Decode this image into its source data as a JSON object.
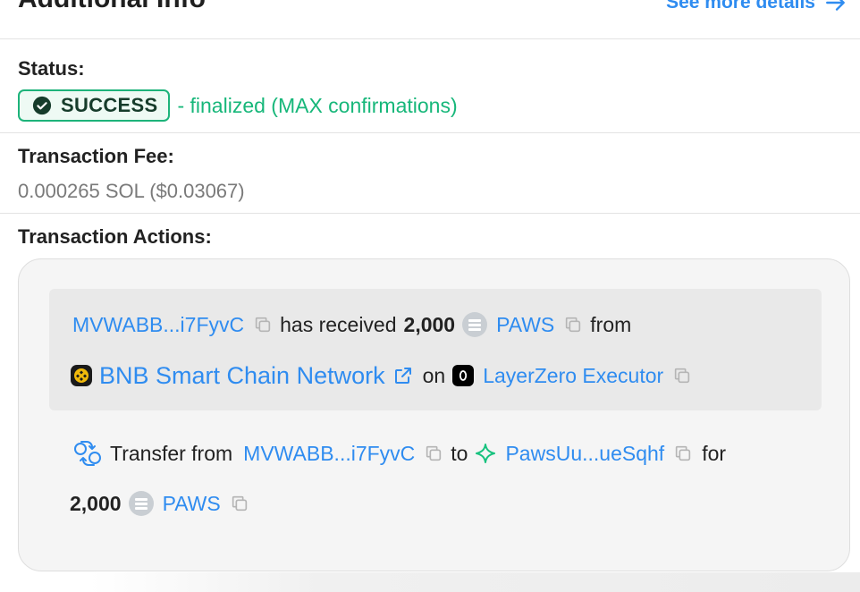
{
  "section": {
    "title": "Additional Info",
    "see_more": "See more details"
  },
  "status": {
    "label": "Status:",
    "badge": "SUCCESS",
    "note": "- finalized (MAX confirmations)",
    "color": "#1db37a"
  },
  "fee": {
    "label": "Transaction Fee:",
    "value": "0.000265 SOL ($0.03067)"
  },
  "actions": {
    "label": "Transaction Actions:",
    "received": {
      "account": "MVWABB...i7FyvC",
      "text_has_received": "has received",
      "amount": "2,000",
      "token": "PAWS",
      "text_from": "from",
      "network": "BNB Smart Chain Network",
      "text_on": "on",
      "executor": "LayerZero Executor"
    },
    "transfer": {
      "text_transfer_from": "Transfer from",
      "from_account": "MVWABB...i7FyvC",
      "text_to": "to",
      "to_account": "PawsUu...ueSqhf",
      "text_for": "for",
      "amount": "2,000",
      "token": "PAWS"
    }
  },
  "colors": {
    "link": "#2f8cf0",
    "success_green": "#17b77a",
    "card_bg": "#f5f5f5"
  },
  "icons": [
    "arrow-right-icon",
    "check-circle-icon",
    "copy-icon",
    "token-icon",
    "bnb-icon",
    "external-link-icon",
    "layerzero-icon",
    "transfer-icon",
    "sparkle-icon"
  ]
}
